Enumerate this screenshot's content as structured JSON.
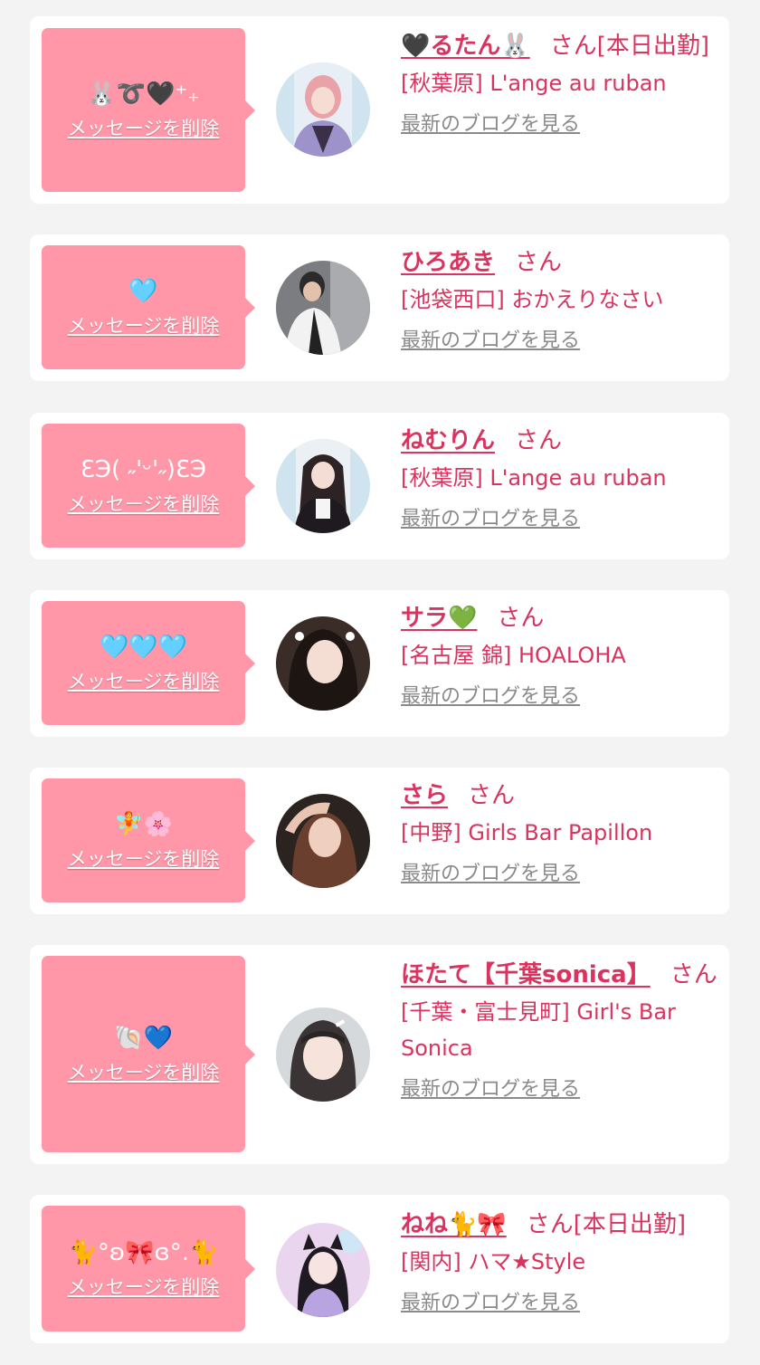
{
  "favorites": [
    {
      "message": "🐰➰🖤⁺₊",
      "delete_label": "メッセージを削除",
      "name": "🖤るたん🐰",
      "suffix": "さん[本日出勤]",
      "shop": "[秋葉原] L'ange au ruban",
      "blog_link": "最新のブログを見る"
    },
    {
      "message": "🩵",
      "delete_label": "メッセージを削除",
      "name": "ひろあき",
      "suffix": "さん",
      "shop": "[池袋西口] おかえりなさい",
      "blog_link": "最新のブログを見る"
    },
    {
      "message": "ƐЭ( ˶'ᵕ'˶)ƐЭ",
      "delete_label": "メッセージを削除",
      "name": "ねむりん",
      "suffix": "さん",
      "shop": "[秋葉原] L'ange au ruban",
      "blog_link": "最新のブログを見る"
    },
    {
      "message": "🩵🩵🩵",
      "delete_label": "メッセージを削除",
      "name": "サラ💚",
      "suffix": "さん",
      "shop": "[名古屋 錦] HOALOHA",
      "blog_link": "最新のブログを見る"
    },
    {
      "message": "🧚🌸",
      "delete_label": "メッセージを削除",
      "name": "さら",
      "suffix": "さん",
      "shop": "[中野] Girls Bar Papillon",
      "blog_link": "最新のブログを見る"
    },
    {
      "message": "🐚💙",
      "delete_label": "メッセージを削除",
      "name": "ほたて【千葉sonica】",
      "suffix": "さん",
      "shop": "[千葉・富士見町] Girl's Bar Sonica",
      "blog_link": "最新のブログを見る"
    },
    {
      "message": "🐈°ʚ🎀ɞ°.🐈",
      "delete_label": "メッセージを削除",
      "name": "ねね🐈🎀",
      "suffix": "さん[本日出勤]",
      "shop": "[関内] ハマ★Style",
      "blog_link": "最新のブログを見る"
    }
  ]
}
